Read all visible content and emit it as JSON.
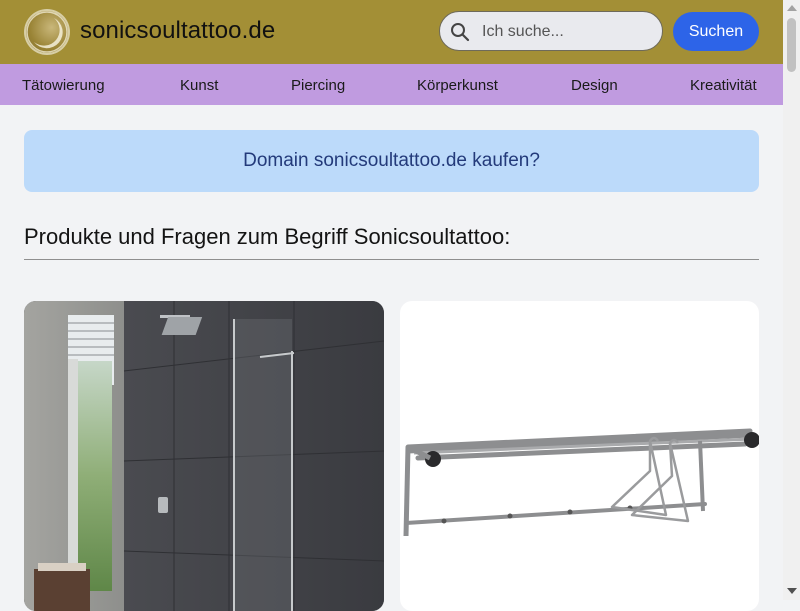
{
  "header": {
    "site_name": "sonicsoultattoo.de",
    "background_color": "#a38f36"
  },
  "search": {
    "placeholder": "Ich suche...",
    "button_label": "Suchen",
    "button_color": "#2d64e8"
  },
  "nav": {
    "background_color": "#c09be0",
    "items": [
      {
        "label": "Tätowierung"
      },
      {
        "label": "Kunst"
      },
      {
        "label": "Piercing"
      },
      {
        "label": "Körperkunst"
      },
      {
        "label": "Design"
      },
      {
        "label": "Kreativität"
      }
    ]
  },
  "banner": {
    "text": "Domain sonicsoultattoo.de kaufen?",
    "background_color": "#bcdafa"
  },
  "section": {
    "title": "Produkte und Fragen zum Begriff Sonicsoultattoo:"
  },
  "products": [
    {
      "image": "walk-in-shower-glass-panel"
    },
    {
      "image": "wall-mounted-towel-rack-with-hangers"
    }
  ]
}
